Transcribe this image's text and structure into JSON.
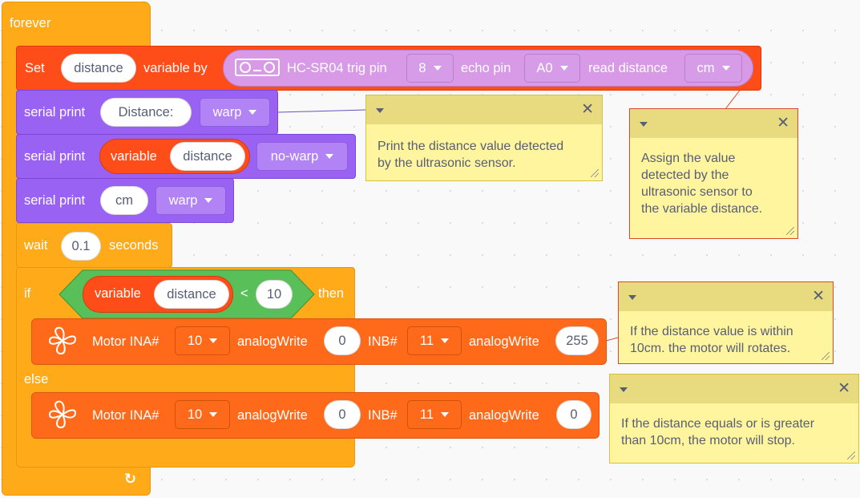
{
  "forever": {
    "label": "forever"
  },
  "set_block": {
    "set_label": "Set",
    "variable": "distance",
    "variable_by_label": "variable by",
    "sensor_label": "HC-SR04 trig pin",
    "trig_pin": "8",
    "echo_label": "echo pin",
    "echo_pin": "A0",
    "read_label": "read distance",
    "unit": "cm",
    "icon": "ultrasonic-sensor-icon"
  },
  "serial1": {
    "label": "serial print",
    "text": "Distance:",
    "mode": "warp"
  },
  "serial2": {
    "label": "serial print",
    "variable_label": "variable",
    "variable": "distance",
    "mode": "no-warp"
  },
  "serial3": {
    "label": "serial print",
    "text": "cm",
    "mode": "warp"
  },
  "wait_block": {
    "wait_label": "wait",
    "value": "0.1",
    "seconds_label": "seconds"
  },
  "if_block": {
    "if_label": "if",
    "variable_label": "variable",
    "variable": "distance",
    "operator": "<",
    "value": "10",
    "then_label": "then",
    "else_label": "else"
  },
  "motor1": {
    "label": "Motor INA#",
    "ina": "10",
    "aw1_label": "analogWrite",
    "aw1": "0",
    "inb_label": "INB#",
    "inb": "11",
    "aw2_label": "analogWrite",
    "aw2": "255",
    "icon": "fan-icon"
  },
  "motor2": {
    "label": "Motor INA#",
    "ina": "10",
    "aw1_label": "analogWrite",
    "aw1": "0",
    "inb_label": "INB#",
    "inb": "11",
    "aw2_label": "analogWrite",
    "aw2": "0",
    "icon": "fan-icon"
  },
  "notes": {
    "n1": [
      "Print the distance value detected",
      "by the ultrasonic sensor."
    ],
    "n2": [
      "Assign the value",
      "detected by the",
      "ultrasonic sensor to",
      "the variable distance."
    ],
    "n3": [
      "If the distance value is within",
      "10cm. the motor will rotates."
    ],
    "n4": [
      "If the distance equals or is greater",
      "than 10cm, the motor will stop."
    ]
  },
  "colors": {
    "control": "#ffab19",
    "set": "#ff4d1a",
    "serial": "#9a62f2",
    "motor": "#ff6a1a",
    "operator": "#59c059",
    "note": "#fff59e"
  }
}
